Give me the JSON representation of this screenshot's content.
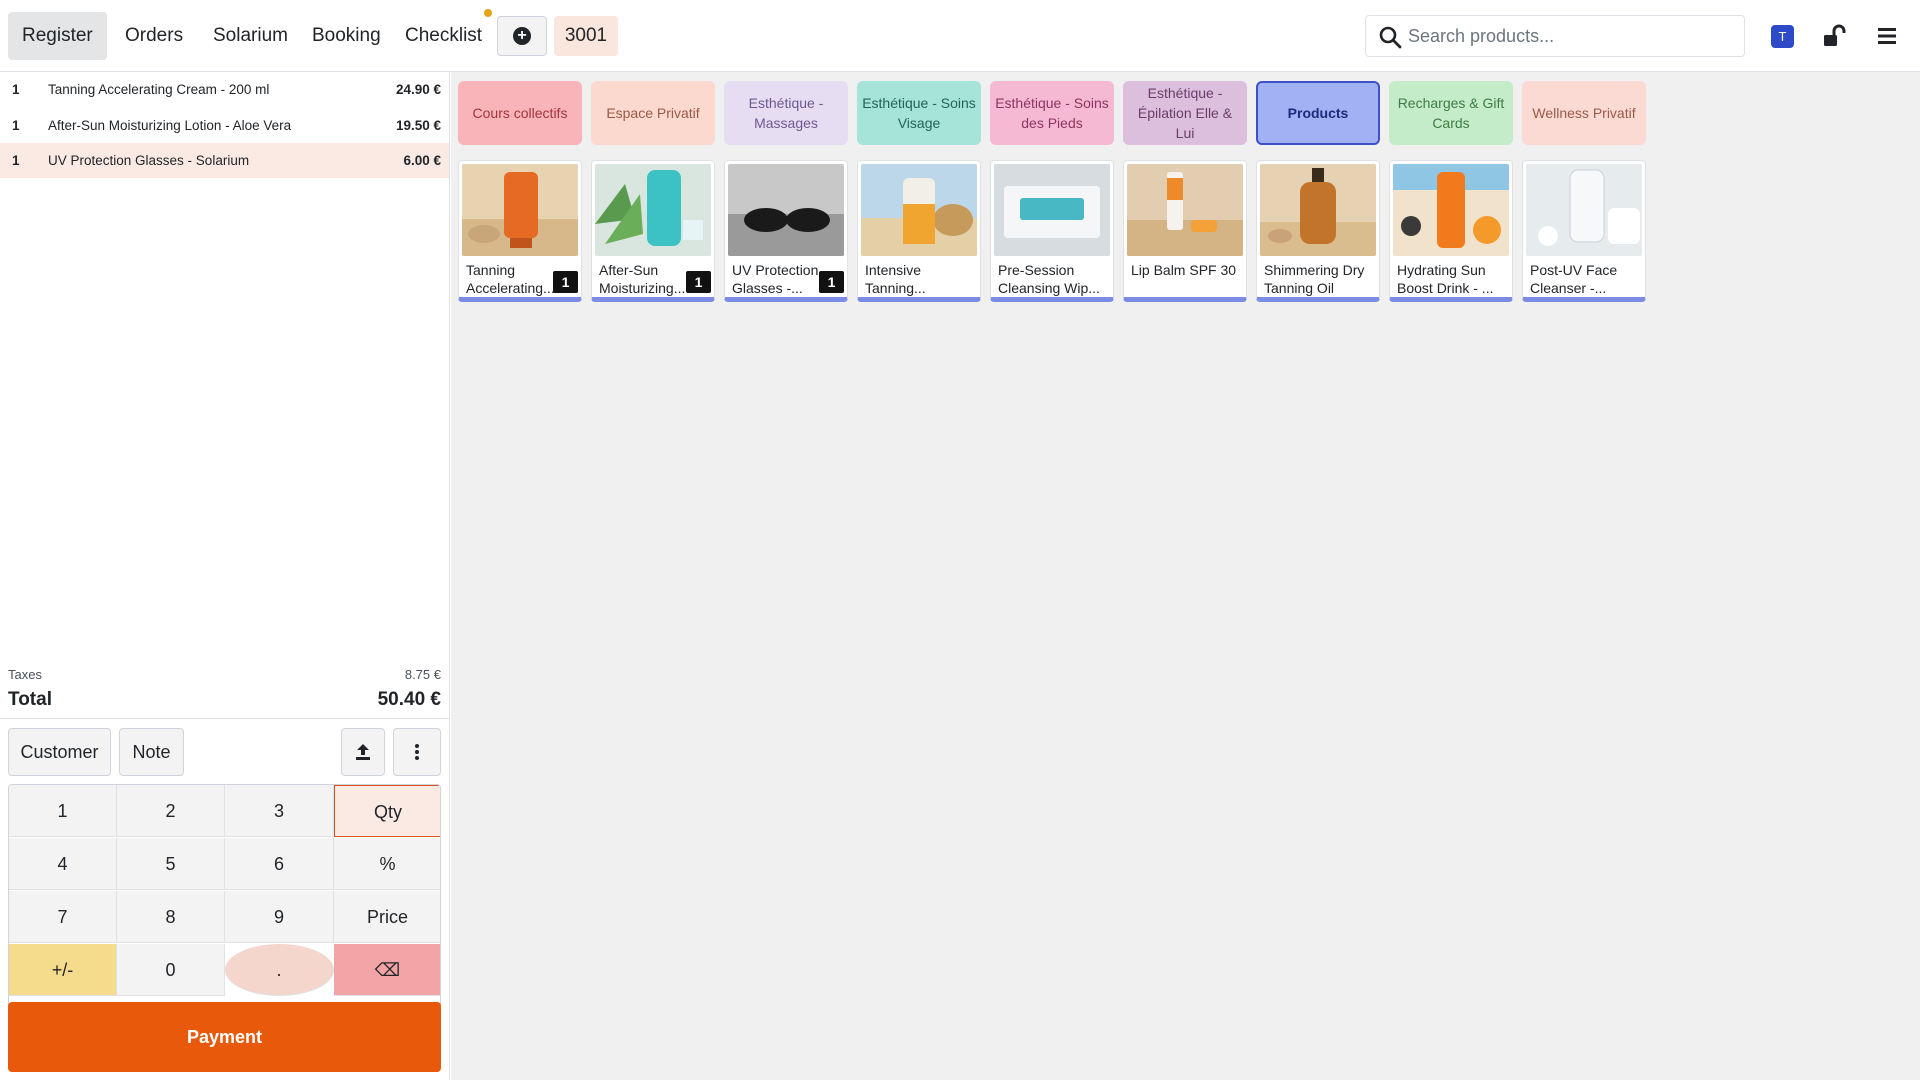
{
  "header": {
    "tabs": [
      {
        "label": "Register",
        "active": true
      },
      {
        "label": "Orders"
      },
      {
        "label": "Solarium"
      },
      {
        "label": "Booking"
      },
      {
        "label": "Checklist"
      }
    ],
    "order_number": "3001",
    "search_placeholder": "Search products...",
    "user_initial": "T"
  },
  "order": {
    "lines": [
      {
        "qty": "1",
        "name": "Tanning Accelerating Cream - 200 ml",
        "price": "24.90 €"
      },
      {
        "qty": "1",
        "name": "After-Sun Moisturizing Lotion - Aloe Vera",
        "price": "19.50 €"
      },
      {
        "qty": "1",
        "name": "UV Protection Glasses - Solarium",
        "price": "6.00 €",
        "selected": true
      }
    ],
    "taxes_label": "Taxes",
    "taxes_value": "8.75 €",
    "total_label": "Total",
    "total_value": "50.40 €"
  },
  "controls": {
    "customer": "Customer",
    "note": "Note"
  },
  "numpad": {
    "keys": [
      "1",
      "2",
      "3",
      "Qty",
      "4",
      "5",
      "6",
      "%",
      "7",
      "8",
      "9",
      "Price",
      "+/-",
      "0",
      ".",
      "⌫"
    ]
  },
  "payment_label": "Payment",
  "categories": [
    {
      "label": "Cours collectifs",
      "color": "#f8b4b9"
    },
    {
      "label": "Espace Privatif",
      "color": "#fbd9cf"
    },
    {
      "label": "Esthétique - Massages",
      "color": "#e6ddf3"
    },
    {
      "label": "Esthétique - Soins Visage",
      "color": "#a6e3d8"
    },
    {
      "label": "Esthétique - Soins des Pieds",
      "color": "#f6b9d4"
    },
    {
      "label": "Esthétique - Épilation Elle & Lui",
      "color": "#dcbfdc"
    },
    {
      "label": "Products",
      "color": "#a2b1f4",
      "active": true
    },
    {
      "label": "Recharges & Gift Cards",
      "color": "#c4ecc8"
    },
    {
      "label": "Wellness Privatif",
      "color": "#fbdad4"
    }
  ],
  "products": [
    {
      "name": "Tanning Accelerating...",
      "badge": "1"
    },
    {
      "name": "After-Sun Moisturizing...",
      "badge": "1"
    },
    {
      "name": "UV Protection Glasses -...",
      "badge": "1"
    },
    {
      "name": "Intensive Tanning..."
    },
    {
      "name": "Pre-Session Cleansing Wip..."
    },
    {
      "name": "Lip Balm SPF 30"
    },
    {
      "name": "Shimmering Dry Tanning Oil"
    },
    {
      "name": "Hydrating Sun Boost Drink - ..."
    },
    {
      "name": "Post-UV Face Cleanser -..."
    }
  ]
}
